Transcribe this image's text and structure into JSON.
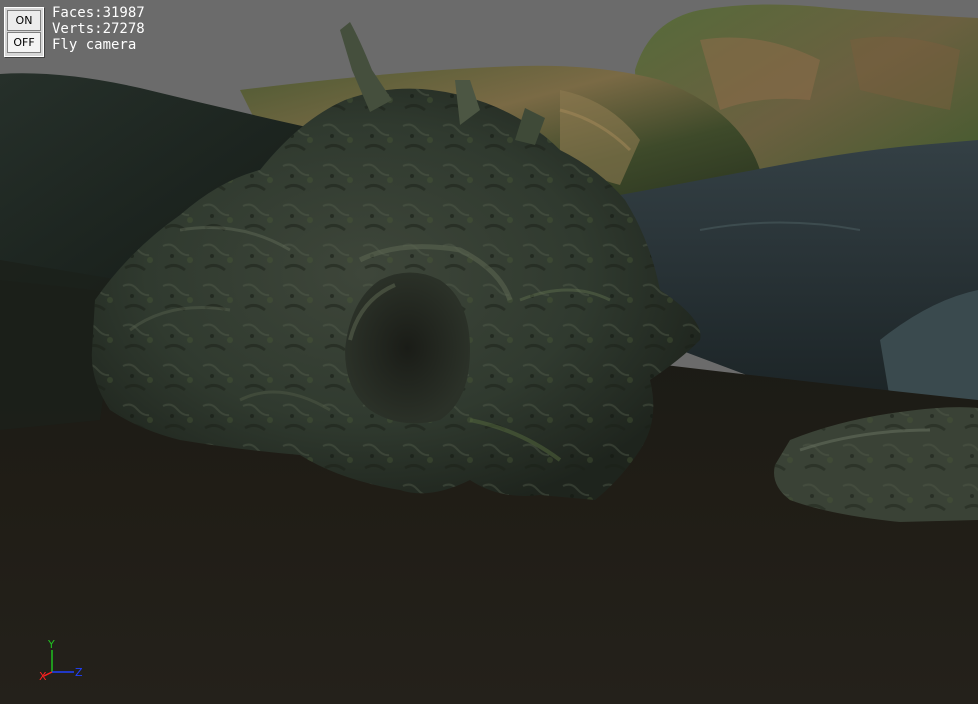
{
  "toggle": {
    "on_label": "ON",
    "off_label": "OFF"
  },
  "stats": {
    "faces": "Faces:31987",
    "verts": "Verts:27278",
    "mode": "Fly camera"
  },
  "axes": {
    "x": "X",
    "y": "Y",
    "z": "Z"
  },
  "colors": {
    "axis_x": "#ff2020",
    "axis_y": "#20c020",
    "axis_z": "#2040ff",
    "sky": "#6b6b6b"
  }
}
